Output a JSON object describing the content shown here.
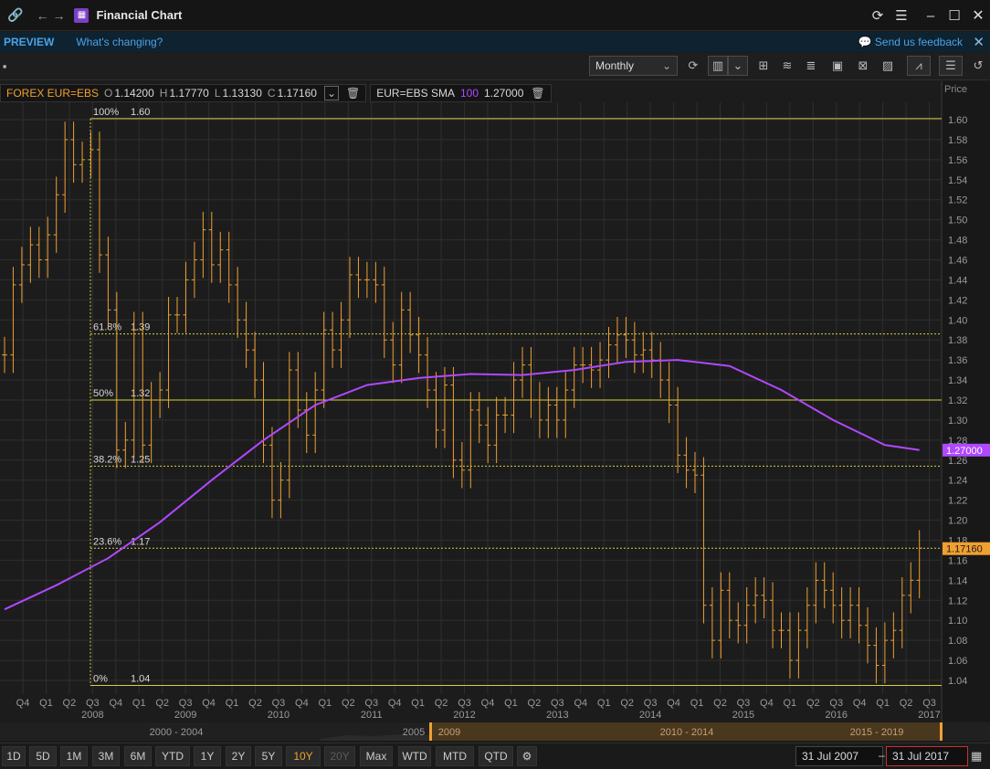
{
  "window": {
    "title": "Financial Chart"
  },
  "preview_bar": {
    "label": "PREVIEW",
    "whats_changing": "What's changing?",
    "feedback": "Send us feedback"
  },
  "toolbar": {
    "period": "Monthly"
  },
  "legend": {
    "symbol": "FOREX EUR=EBS",
    "o_key": "O",
    "o_val": "1.14200",
    "h_key": "H",
    "h_val": "1.17770",
    "l_key": "L",
    "l_val": "1.13130",
    "c_key": "C",
    "c_val": "1.17160",
    "sma_name": "EUR=EBS SMA",
    "sma_len": "100",
    "sma_val": "1.27000"
  },
  "axis": {
    "price_header": "Price"
  },
  "colors": {
    "bars": "#f0a030",
    "sma": "#b048ff",
    "fib": "#d8d040",
    "grid": "#2f2f2f"
  },
  "chart_data": {
    "type": "line",
    "y_axis": {
      "ylim": [
        1.03,
        1.62
      ],
      "ticks": [
        "1.04",
        "1.06",
        "1.08",
        "1.10",
        "1.12",
        "1.14",
        "1.16",
        "1.18",
        "1.20",
        "1.22",
        "1.24",
        "1.26",
        "1.28",
        "1.30",
        "1.32",
        "1.34",
        "1.36",
        "1.38",
        "1.40",
        "1.42",
        "1.44",
        "1.46",
        "1.48",
        "1.50",
        "1.52",
        "1.54",
        "1.56",
        "1.58",
        "1.60"
      ]
    },
    "x_quarter_labels": [
      "Q4",
      "Q1",
      "Q2",
      "Q3",
      "Q4",
      "Q1",
      "Q2",
      "Q3",
      "Q4",
      "Q1",
      "Q2",
      "Q3",
      "Q4",
      "Q1",
      "Q2",
      "Q3",
      "Q4",
      "Q1",
      "Q2",
      "Q3",
      "Q4",
      "Q1",
      "Q2",
      "Q3",
      "Q4",
      "Q1",
      "Q2",
      "Q3",
      "Q4",
      "Q1",
      "Q2",
      "Q3",
      "Q4",
      "Q1",
      "Q2",
      "Q3",
      "Q4",
      "Q1",
      "Q2",
      "Q3"
    ],
    "x_year_labels": [
      {
        "label": "2008",
        "quarter_index": 3
      },
      {
        "label": "2009",
        "quarter_index": 7
      },
      {
        "label": "2010",
        "quarter_index": 11
      },
      {
        "label": "2011",
        "quarter_index": 15
      },
      {
        "label": "2012",
        "quarter_index": 19
      },
      {
        "label": "2013",
        "quarter_index": 23
      },
      {
        "label": "2014",
        "quarter_index": 27
      },
      {
        "label": "2015",
        "quarter_index": 31
      },
      {
        "label": "2016",
        "quarter_index": 35
      },
      {
        "label": "2017",
        "quarter_index": 39
      }
    ],
    "fib_levels": [
      {
        "label": "100%",
        "value_label": "1.60",
        "value": 1.601,
        "style": "solid"
      },
      {
        "label": "61.8%",
        "value_label": "1.39",
        "value": 1.386,
        "style": "dotted"
      },
      {
        "label": "50%",
        "value_label": "1.32",
        "value": 1.32,
        "style": "solid"
      },
      {
        "label": "38.2%",
        "value_label": "1.25",
        "value": 1.254,
        "style": "dotted"
      },
      {
        "label": "23.6%",
        "value_label": "1.17",
        "value": 1.172,
        "style": "dotted"
      },
      {
        "label": "0%",
        "value_label": "1.04",
        "value": 1.035,
        "style": "solid"
      }
    ],
    "series": [
      {
        "name": "FOREX EUR=EBS",
        "style": "hlc-bars",
        "start": "2007-07",
        "step": "month",
        "close": [
          1.365,
          1.435,
          1.455,
          1.475,
          1.46,
          1.485,
          1.525,
          1.58,
          1.555,
          1.56,
          1.57,
          1.465,
          1.41,
          1.27,
          1.28,
          1.39,
          1.275,
          1.32,
          1.33,
          1.405,
          1.405,
          1.44,
          1.46,
          1.49,
          1.455,
          1.47,
          1.435,
          1.4,
          1.37,
          1.34,
          1.275,
          1.22,
          1.24,
          1.35,
          1.31,
          1.285,
          1.33,
          1.39,
          1.37,
          1.4,
          1.445,
          1.44,
          1.44,
          1.435,
          1.38,
          1.355,
          1.41,
          1.385,
          1.365,
          1.33,
          1.29,
          1.335,
          1.26,
          1.25,
          1.31,
          1.295,
          1.275,
          1.305,
          1.305,
          1.34,
          1.355,
          1.32,
          1.3,
          1.315,
          1.3,
          1.33,
          1.355,
          1.355,
          1.35,
          1.36,
          1.375,
          1.385,
          1.38,
          1.365,
          1.37,
          1.36,
          1.34,
          1.315,
          1.265,
          1.25,
          1.245,
          1.115,
          1.08,
          1.13,
          1.1,
          1.095,
          1.115,
          1.125,
          1.12,
          1.09,
          1.09,
          1.06,
          1.09,
          1.115,
          1.14,
          1.13,
          1.115,
          1.1,
          1.115,
          1.095,
          1.075,
          1.055,
          1.08,
          1.09,
          1.125,
          1.14,
          1.172
        ],
        "high_above_close": 0.03,
        "low_below_close": 0.03
      },
      {
        "name": "EUR=EBS SMA 100",
        "style": "line",
        "points": [
          [
            0,
            1.111
          ],
          [
            6,
            1.135
          ],
          [
            12,
            1.162
          ],
          [
            18,
            1.198
          ],
          [
            24,
            1.24
          ],
          [
            30,
            1.28
          ],
          [
            36,
            1.315
          ],
          [
            42,
            1.335
          ],
          [
            48,
            1.342
          ],
          [
            54,
            1.346
          ],
          [
            60,
            1.345
          ],
          [
            66,
            1.35
          ],
          [
            72,
            1.358
          ],
          [
            78,
            1.36
          ],
          [
            84,
            1.354
          ],
          [
            90,
            1.33
          ],
          [
            96,
            1.3
          ],
          [
            102,
            1.275
          ],
          [
            106,
            1.27
          ]
        ],
        "x_units": "months since Jul 2007",
        "last_label": "1.27000"
      }
    ],
    "last_price_label": "1.17160"
  },
  "range_bar": {
    "labels": [
      "2000 - 2004",
      "2005",
      "2009",
      "2010 - 2014",
      "2015 - 2019"
    ]
  },
  "period_buttons": [
    {
      "label": "1D",
      "state": "normal"
    },
    {
      "label": "5D",
      "state": "normal"
    },
    {
      "label": "1M",
      "state": "normal"
    },
    {
      "label": "3M",
      "state": "normal"
    },
    {
      "label": "6M",
      "state": "normal"
    },
    {
      "label": "YTD",
      "state": "normal"
    },
    {
      "label": "1Y",
      "state": "normal"
    },
    {
      "label": "2Y",
      "state": "normal"
    },
    {
      "label": "5Y",
      "state": "normal"
    },
    {
      "label": "10Y",
      "state": "active"
    },
    {
      "label": "20Y",
      "state": "disabled"
    },
    {
      "label": "Max",
      "state": "normal"
    },
    {
      "label": "WTD",
      "state": "normal"
    },
    {
      "label": "MTD",
      "state": "normal"
    },
    {
      "label": "QTD",
      "state": "normal"
    }
  ],
  "dates": {
    "from": "31 Jul 2007",
    "separator": "–",
    "to": "31 Jul 2017"
  }
}
